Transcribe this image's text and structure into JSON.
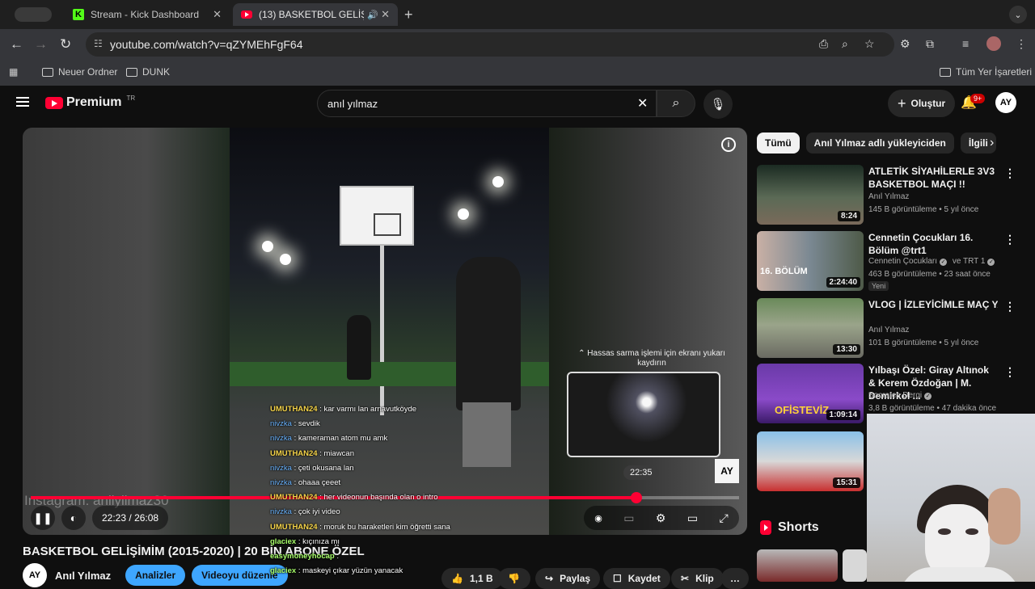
{
  "browser": {
    "tabs": [
      {
        "title": "Stream - Kick Dashboard"
      },
      {
        "title": "(13) BASKETBOL GELİŞİMİ"
      }
    ],
    "url": "youtube.com/watch?v=qZYMEhFgF64",
    "bookmarks": [
      "Neuer Ordner",
      "DUNK"
    ],
    "all_bookmarks": "Tüm Yer İşaretleri"
  },
  "header": {
    "logo_text": "Premium",
    "logo_region": "TR",
    "search_value": "anıl yılmaz",
    "create_label": "Oluştur",
    "notif_count": "9+",
    "avatar_text": "AY"
  },
  "player": {
    "watermark": "Instagram: anilyilmaz30",
    "hint": "Hassas sarma işlemi için ekranı yukarı kaydırın",
    "preview_time": "22:35",
    "brand_badge": "AY",
    "time_current": "22:23",
    "time_separator": "/",
    "time_total": "26:08",
    "progress_fraction": 0.855
  },
  "chat": [
    {
      "user": "UMUTHAN24",
      "msg": ": kar varmı lan arnavutköyde",
      "style": "gold"
    },
    {
      "user": "nivzka",
      "msg": ": sevdik",
      "style": "blue"
    },
    {
      "user": "nivzka",
      "msg": ": kameraman atom mu amk",
      "style": "blue"
    },
    {
      "user": "UMUTHAN24",
      "msg": ": miawcan",
      "style": "gold"
    },
    {
      "user": "nivzka",
      "msg": ": çeti okusana lan",
      "style": "blue"
    },
    {
      "user": "nivzka",
      "msg": ": ohaaa çeeet",
      "style": "blue"
    },
    {
      "user": "UMUTHAN24",
      "msg": ": her videonun başında olan o intro",
      "style": "gold"
    },
    {
      "user": "nivzka",
      "msg": ": çok iyi video",
      "style": "blue"
    },
    {
      "user": "UMUTHAN24",
      "msg": ": moruk bu haraketleri kim öğretti sana",
      "style": "gold"
    },
    {
      "user": "glaciex",
      "msg": ": kıçınıza mı",
      "style": "green"
    },
    {
      "user": "easymoneyhocap",
      "msg": ":",
      "style": "green"
    },
    {
      "user": "glaciex",
      "msg": ": maskeyi çıkar yüzün yanacak",
      "style": "green"
    }
  ],
  "video": {
    "title": "BASKETBOL GELİŞİMİM (2015-2020) | 20 BİN ABONE ÖZEL",
    "channel": "Anıl Yılmaz",
    "channel_avatar": "AY",
    "analytics_label": "Analizler",
    "edit_label": "Videoyu düzenle",
    "likes": "1,1 B",
    "share_label": "Paylaş",
    "save_label": "Kaydet",
    "clip_label": "Klip"
  },
  "chips": [
    "Tümü",
    "Anıl Yılmaz adlı yükleyiciden",
    "İlgili"
  ],
  "recommendations": [
    {
      "title": "ATLETİK SİYAHİLERLE 3V3 BASKETBOL MAÇI !!",
      "channel": "Anıl Yılmaz",
      "meta": "145 B görüntüleme • 5 yıl önce",
      "duration": "8:24"
    },
    {
      "title": "Cennetin Çocukları 16. Bölüm @trt1",
      "channel": "Cennetin Çocukları",
      "channel2": "ve TRT 1",
      "meta": "463 B görüntüleme • 23 saat önce",
      "duration": "2:24:40",
      "badge": "Yeni",
      "thumb_text": "16. BÖLÜM"
    },
    {
      "title": "VLOG | İZLEYİCİMLE MAÇ YAPTIM & BASKETBOL TOPU ...",
      "channel": "Anıl Yılmaz",
      "meta": "101 B görüntüleme • 5 yıl önce",
      "duration": "13:30"
    },
    {
      "title": "Yılbaşı Özel: Giray Altınok & Kerem Özdoğan | M. Demirkol ...",
      "channel": "Socrates Dergi",
      "meta": "3,8 B görüntüleme • 47 dakika önce",
      "duration": "1:09:14",
      "thumb_text": "OFİSTEVİZ"
    },
    {
      "title": "",
      "channel": "",
      "meta": "",
      "duration": "15:31"
    }
  ],
  "shorts_label": "Shorts",
  "colors": {
    "accent": "#ff0033",
    "bg": "#0f0f0f",
    "blue": "#3ea6ff"
  }
}
